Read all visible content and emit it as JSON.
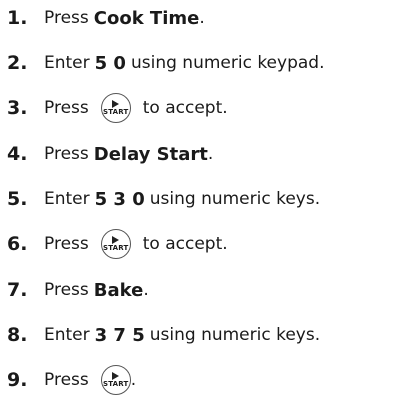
{
  "steps": [
    {
      "num": "1.",
      "pre": "Press",
      "bold": "Cook Time",
      "post": "."
    },
    {
      "num": "2.",
      "pre": "Enter",
      "bold": "5 0",
      "post": "using numeric keypad."
    },
    {
      "num": "3.",
      "pre": "Press",
      "button": "START",
      "post": "to accept."
    },
    {
      "num": "4.",
      "pre": "Press",
      "bold": "Delay Start",
      "post": "."
    },
    {
      "num": "5.",
      "pre": "Enter",
      "bold": "5 3 0",
      "post": "using numeric keys."
    },
    {
      "num": "6.",
      "pre": "Press",
      "button": "START",
      "post": "to accept."
    },
    {
      "num": "7.",
      "pre": "Press",
      "bold": "Bake",
      "post": "."
    },
    {
      "num": "8.",
      "pre": "Enter",
      "bold": "3 7 5",
      "post": "using numeric keys."
    },
    {
      "num": "9.",
      "pre": "Press",
      "button": "START",
      "post": "."
    }
  ]
}
